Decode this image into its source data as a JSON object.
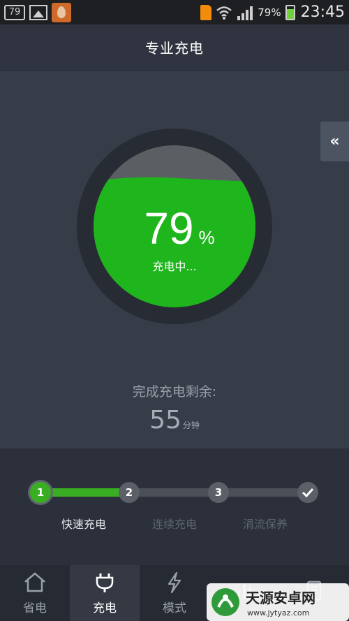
{
  "status_bar": {
    "notification_badge": "79",
    "battery_percent": "79%",
    "time": "23:45"
  },
  "header": {
    "title": "专业充电"
  },
  "side_tab": {
    "label": "«"
  },
  "gauge": {
    "value": "79",
    "unit": "%",
    "status": "充电中...",
    "level": 0.79,
    "fill_color": "#1fb51d",
    "ring_color": "#272b33",
    "empty_color": "#5b5e62"
  },
  "remaining": {
    "label": "完成充电剩余:",
    "value": "55",
    "unit": "分钟"
  },
  "steps": [
    {
      "number": "1",
      "label": "快速充电",
      "active": true
    },
    {
      "number": "2",
      "label": "连续充电",
      "active": false
    },
    {
      "number": "3",
      "label": "涓流保养",
      "active": false
    }
  ],
  "nav": [
    {
      "label": "省电",
      "icon": "home-icon"
    },
    {
      "label": "充电",
      "icon": "plug-icon",
      "active": true
    },
    {
      "label": "模式",
      "icon": "lightning-icon"
    },
    {
      "label": "",
      "icon": "chart-icon"
    },
    {
      "label": "",
      "icon": "document-icon"
    }
  ],
  "watermark": {
    "brand": "天源安卓网",
    "url": "www.jytyaz.com"
  },
  "colors": {
    "accent_green": "#3aae22",
    "background": "#363c48"
  }
}
